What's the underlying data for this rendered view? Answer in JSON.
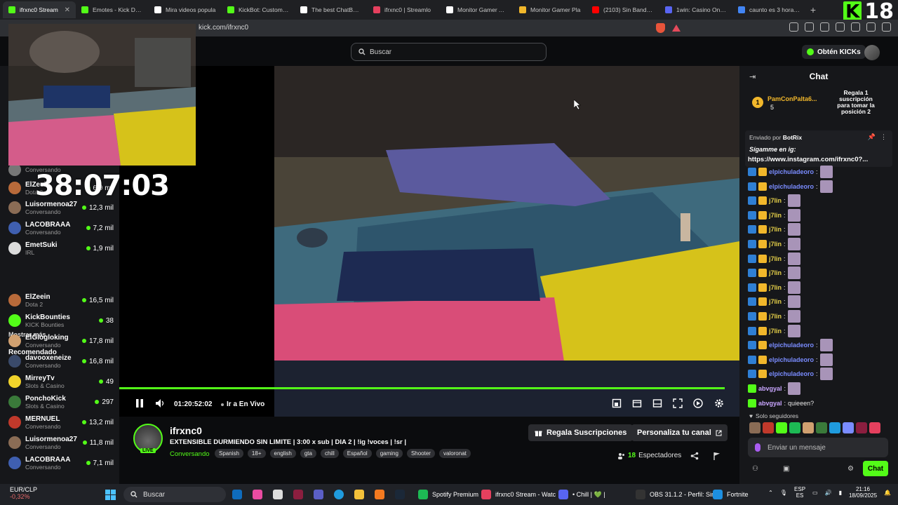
{
  "browser": {
    "tabs": [
      {
        "title": "ifrxnc0 Stream",
        "color": "#53fc18",
        "active": true
      },
      {
        "title": "Emotes - Kick Dash",
        "color": "#53fc18"
      },
      {
        "title": "Mira videos popula",
        "color": "#ffffff"
      },
      {
        "title": "KickBot: Customiza",
        "color": "#53fc18"
      },
      {
        "title": "The best ChatBot ar",
        "color": "#ffffff"
      },
      {
        "title": "ifrxnc0 | Streamlo",
        "color": "#e5405e"
      },
      {
        "title": "Monitor Gamer ASI",
        "color": "#ffffff"
      },
      {
        "title": "Monitor Gamer Pla",
        "color": "#f1b72b"
      },
      {
        "title": "(2103) Sin Bandera",
        "color": "#ff0000"
      },
      {
        "title": "1win: Casino Online",
        "color": "#5965f2"
      },
      {
        "title": "caunto es 3 horas e",
        "color": "#4285f4"
      }
    ],
    "new_tab": "+",
    "url": "kick.com/ifrxnc0",
    "overlay_k": "K",
    "overlay_age": "18"
  },
  "header": {
    "search_placeholder": "Buscar",
    "obtain_label": "Obtén KICKs"
  },
  "overlay": {
    "timer": "38:07:03"
  },
  "sidebar": {
    "following": [
      {
        "name": "",
        "category": "Conversando",
        "viewers": "",
        "color": "#777"
      },
      {
        "name": "ElZeein",
        "category": "Dota 2",
        "viewers": "6,9 mil",
        "color": "#b86a3a"
      },
      {
        "name": "Luisormenoa27",
        "category": "Conversando",
        "viewers": "12,3 mil",
        "color": "#8a6c55"
      },
      {
        "name": "LACOBRAAA",
        "category": "Conversando",
        "viewers": "7,2 mil",
        "color": "#3f5fb0"
      },
      {
        "name": "EmetSuki",
        "category": "IRL",
        "viewers": "1,9 mil",
        "color": "#dcdcdc"
      }
    ],
    "show_more": "Mostrar más",
    "recommended_title": "Recomendado",
    "recommended": [
      {
        "name": "ElZeein",
        "category": "Dota 2",
        "viewers": "16,5 mil",
        "color": "#b86a3a"
      },
      {
        "name": "KickBounties",
        "category": "KICK Bounties",
        "viewers": "38",
        "color": "#53fc18"
      },
      {
        "name": "ElGlogloking",
        "category": "Conversando",
        "viewers": "17,8 mil",
        "color": "#d0a070"
      },
      {
        "name": "davooxeneize",
        "category": "Conversando",
        "viewers": "16,8 mil",
        "color": "#3a4a6a"
      },
      {
        "name": "MirreyTv",
        "category": "Slots & Casino",
        "viewers": "49",
        "color": "#f1d32b"
      },
      {
        "name": "PonchoKick",
        "category": "Slots & Casino",
        "viewers": "297",
        "color": "#3a7a3a"
      },
      {
        "name": "MERNUEL",
        "category": "Conversando",
        "viewers": "13,2 mil",
        "color": "#c0392b"
      },
      {
        "name": "Luisormenoa27",
        "category": "Conversando",
        "viewers": "11,8 mil",
        "color": "#8a6c55"
      },
      {
        "name": "LACOBRAAA",
        "category": "Conversando",
        "viewers": "7,1 mil",
        "color": "#3f5fb0"
      }
    ]
  },
  "player": {
    "progress": 0.99,
    "time": "01:20:52:02",
    "go_live": "Ir a En Vivo"
  },
  "stream": {
    "channel": "ifrxnc0",
    "live_badge": "LIVE",
    "title": "EXTENSIBLE DURMIENDO SIN LIMITE | 3:00 x sub | DIA 2 | !ig !voces | !sr |",
    "category": "Conversando",
    "tags": [
      "Spanish",
      "18+",
      "english",
      "gta",
      "chill",
      "Español",
      "gaming",
      "Shooter",
      "valoronat"
    ],
    "gift_subs_label": "Regala Suscripciones",
    "customize_label": "Personaliza tu canal",
    "viewer_count": "18",
    "viewer_label": "Espectadores"
  },
  "chat": {
    "title": "Chat",
    "top_gifter_rank": "1",
    "top_gifter": "PamConPalta6...",
    "top_gifter_count": "5",
    "gift_tip": "Regala 1 suscripción para tomar la posición 2",
    "pinned_by_label": "Enviado por",
    "pinned_by": "BotRix",
    "pinned_msg": "Sígamme en ig:",
    "pinned_link": "https://www.instagram.com/ifrxnc0?...",
    "messages": [
      {
        "user": "elpichuladeoro",
        "text": "",
        "color": "#7a8cff",
        "emote": true
      },
      {
        "user": "elpichuladeoro",
        "text": "",
        "color": "#7a8cff",
        "emote": true
      },
      {
        "user": "j7lin",
        "text": "",
        "color": "#e8d24a",
        "emote": true
      },
      {
        "user": "j7lin",
        "text": "",
        "color": "#e8d24a",
        "emote": true
      },
      {
        "user": "j7lin",
        "text": "",
        "color": "#e8d24a",
        "emote": true
      },
      {
        "user": "j7lin",
        "text": "",
        "color": "#e8d24a",
        "emote": true
      },
      {
        "user": "j7lin",
        "text": "",
        "color": "#e8d24a",
        "emote": true
      },
      {
        "user": "j7lin",
        "text": "",
        "color": "#e8d24a",
        "emote": true
      },
      {
        "user": "j7lin",
        "text": "",
        "color": "#e8d24a",
        "emote": true
      },
      {
        "user": "j7lin",
        "text": "",
        "color": "#e8d24a",
        "emote": true
      },
      {
        "user": "j7lin",
        "text": "",
        "color": "#e8d24a",
        "emote": true
      },
      {
        "user": "j7lin",
        "text": "",
        "color": "#e8d24a",
        "emote": true
      },
      {
        "user": "elpichuladeoro",
        "text": "",
        "color": "#7a8cff",
        "emote": true
      },
      {
        "user": "elpichuladeoro",
        "text": "",
        "color": "#7a8cff",
        "emote": true
      },
      {
        "user": "elpichuladeoro",
        "text": "",
        "color": "#7a8cff",
        "emote": true
      },
      {
        "user": "abvgyal",
        "text": "",
        "color": "#c9a6ff",
        "emote": true
      },
      {
        "user": "abvgyal",
        "text": "quieeen?",
        "color": "#c9a6ff",
        "emote": false
      }
    ],
    "followers_only": "Solo seguidores",
    "input_placeholder": "Enviar un mensaje",
    "send_label": "Chat"
  },
  "taskbar": {
    "ticker": "EUR/CLP",
    "ticker_change": "-0,32%",
    "search": "Buscar",
    "apps": [
      {
        "label": "Spotify Premium",
        "color": "#1db954"
      },
      {
        "label": "ifrxnc0 Stream - Watc",
        "color": "#e5405e"
      },
      {
        "label": "• Chill | 💚 |",
        "color": "#5865f2"
      },
      {
        "label": "OBS 31.1.2 - Perfil: Sin",
        "color": "#333"
      },
      {
        "label": "Fortnite",
        "color": "#1d8fe0"
      }
    ],
    "lang": "ESP",
    "lang2": "ES",
    "time": "21:16",
    "date": "18/09/2025"
  }
}
